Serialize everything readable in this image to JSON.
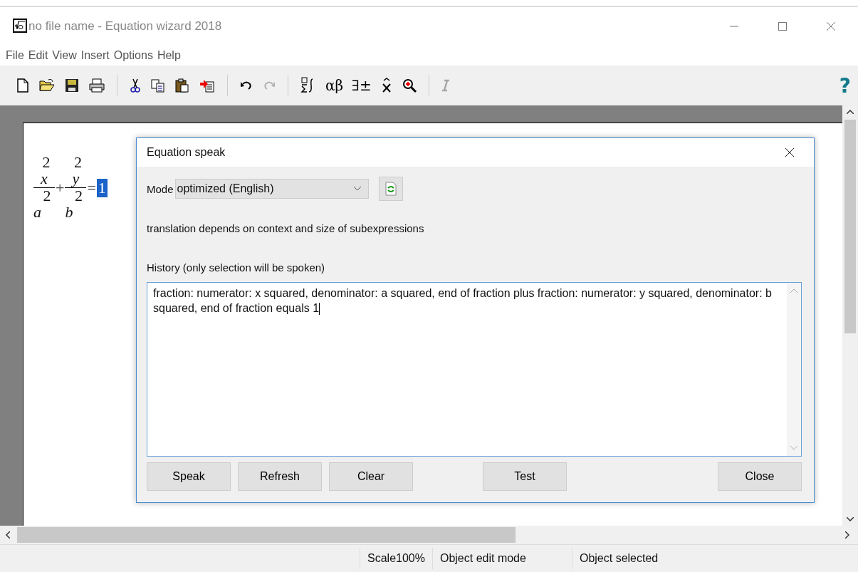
{
  "window": {
    "title": "no file name - Equation wizard 2018"
  },
  "menu": [
    "File",
    "Edit",
    "View",
    "Insert",
    "Options",
    "Help"
  ],
  "toolbar": [
    {
      "kind": "new",
      "disabled": false
    },
    {
      "kind": "open",
      "disabled": false
    },
    {
      "kind": "save",
      "disabled": false
    },
    {
      "kind": "print",
      "disabled": false
    },
    {
      "kind": "sep"
    },
    {
      "kind": "cut",
      "disabled": false
    },
    {
      "kind": "copy",
      "disabled": false
    },
    {
      "kind": "paste",
      "disabled": false
    },
    {
      "kind": "paste-special",
      "disabled": false
    },
    {
      "kind": "sep"
    },
    {
      "kind": "undo",
      "disabled": false
    },
    {
      "kind": "redo",
      "disabled": true
    },
    {
      "kind": "sep"
    },
    {
      "kind": "template",
      "disabled": false
    },
    {
      "kind": "text",
      "label": "αβ",
      "disabled": false
    },
    {
      "kind": "text",
      "label": "∃±",
      "disabled": false
    },
    {
      "kind": "hat",
      "disabled": false
    },
    {
      "kind": "zoom",
      "disabled": false
    },
    {
      "kind": "sep"
    },
    {
      "kind": "italic",
      "disabled": true
    }
  ],
  "help": "?",
  "equation": {
    "fractions": [
      {
        "numerator_exp": "2",
        "numerator": "x",
        "denominator_exp": "2",
        "denominator": "a"
      },
      {
        "numerator_exp": "2",
        "numerator": "y",
        "denominator_exp": "2",
        "denominator": "b"
      }
    ],
    "operator": "+",
    "equals": "=",
    "rhs": {
      "text": "1",
      "selected": true
    }
  },
  "dialog": {
    "title": "Equation speak",
    "mode_label": "Mode",
    "mode_value": "optimized (English)",
    "info": "translation depends on context and size of subexpressions",
    "history_label": "History (only selection will be spoken)",
    "history_text": " fraction: numerator: x squared, denominator: a squared, end of fraction plus fraction: numerator: y squared, denominator: b squared, end of fraction equals 1",
    "buttons_left": [
      "Speak",
      "Refresh",
      "Clear"
    ],
    "buttons_middle": [
      "Test"
    ],
    "buttons_right": [
      "Close"
    ]
  },
  "status_bar": [
    "Scale100%",
    "Object edit mode",
    "Object selected"
  ]
}
